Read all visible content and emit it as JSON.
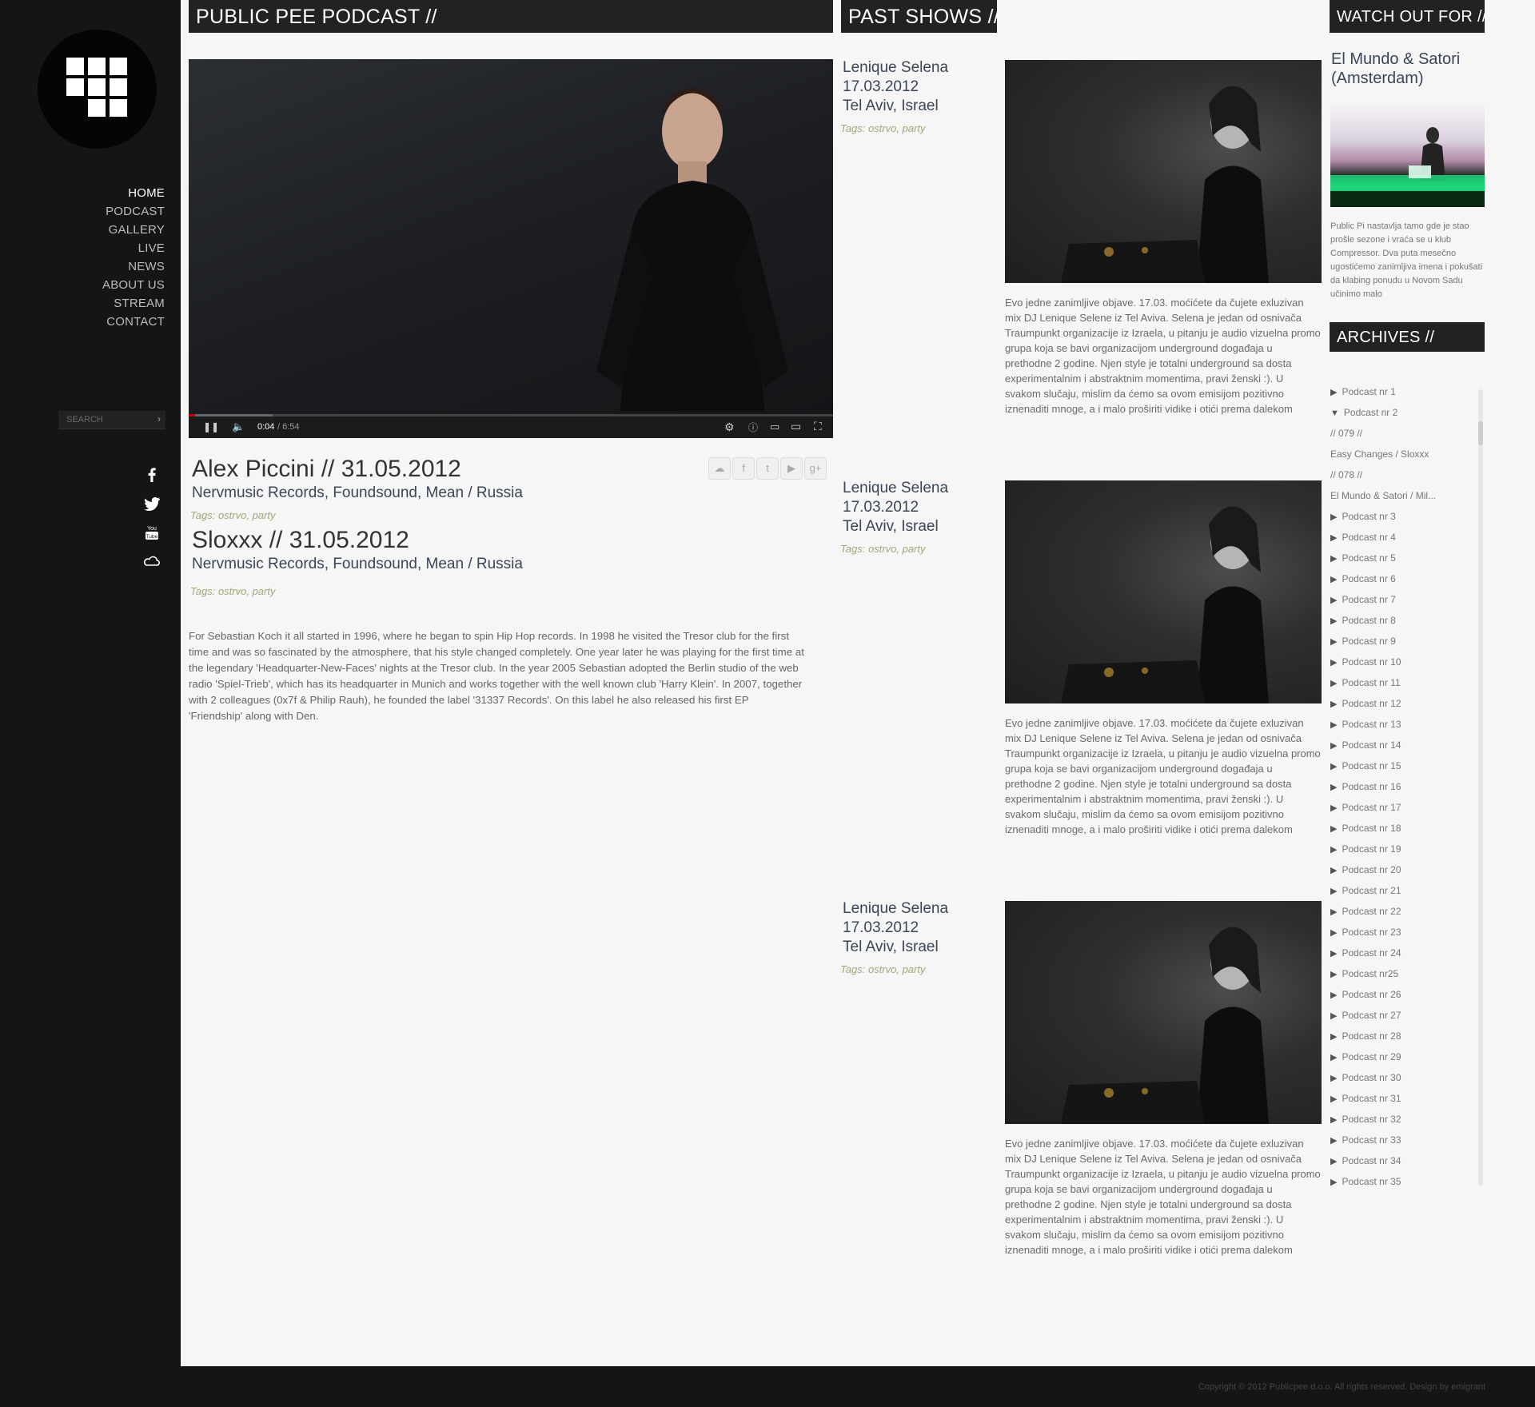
{
  "nav": {
    "items": [
      "HOME",
      "PODCAST",
      "GALLERY",
      "LIVE",
      "NEWS",
      "ABOUT US",
      "STREAM",
      "CONTACT"
    ],
    "active": "HOME"
  },
  "search": {
    "placeholder": "SEARCH",
    "go_icon": "chevron-right-icon"
  },
  "social_icons": [
    "facebook-icon",
    "twitter-icon",
    "youtube-icon",
    "soundcloud-icon"
  ],
  "main": {
    "header": "PUBLIC PEE PODCAST //",
    "video": {
      "time_current": "0:04",
      "time_total": "/ 6:54",
      "progress": 0.01
    },
    "share_icons": [
      "soundcloud-icon",
      "facebook-icon",
      "twitter-icon",
      "youtube-icon",
      "googleplus-icon"
    ],
    "shows": [
      {
        "title": "Alex Piccini // 31.05.2012",
        "subtitle": "Nervmusic Records, Foundsound, Mean / Russia",
        "tags_label": "Tags:",
        "tags": "ostrvo, party"
      },
      {
        "title": "Sloxxx // 31.05.2012",
        "subtitle": "Nervmusic Records, Foundsound, Mean / Russia",
        "tags_label": "Tags:",
        "tags": "ostrvo, party"
      }
    ],
    "bio": "For Sebastian Koch it all started in 1996, where he began to spin Hip Hop records. In 1998 he visited the Tresor club for the first time and was so fascinated by the atmosphere, that his style changed completely. One year later he was playing for the first time at the legendary 'Headquarter-New-Faces' nights at the Tresor club. In the year 2005 Sebastian adopted the Berlin studio of the web radio 'Spiel-Trieb', which has its headquarter in Munich and works together with the well known club 'Harry Klein'. In 2007, together with 2 colleagues (0x7f & Philip Rauh), he founded the label '31337 Records'. On this label he also released his first EP 'Friendship' along with Den."
  },
  "past_shows": {
    "header": "PAST SHOWS //",
    "items": [
      {
        "name": "Lenique Selena",
        "date": "17.03.2012",
        "place": "Tel Aviv, Israel",
        "tags_label": "Tags:",
        "tags": "ostrvo, party",
        "text": "Evo jedne zanimljive objave. 17.03. moćićete da čujete exluzivan mix DJ Lenique Selene iz Tel Aviva. Selena je jedan od osnivača Traumpunkt organizacije iz Izraela, u pitanju je audio vizuelna promo grupa koja se bavi organizacijom underground događaja u prethodne 2 godine. Njen style je totalni underground sa dosta experimentalnim i abstraktnim momentima, pravi ženski :). U svakom slučaju, mislim da ćemo sa ovom emisijom pozitivno iznenaditi mnoge, a i malo proširiti vidike i otići prema dalekom"
      },
      {
        "name": "Lenique Selena",
        "date": "17.03.2012",
        "place": "Tel Aviv, Israel",
        "tags_label": "Tags:",
        "tags": "ostrvo, party",
        "text": "Evo jedne zanimljive objave. 17.03. moćićete da čujete exluzivan mix DJ Lenique Selene iz Tel Aviva. Selena je jedan od osnivača Traumpunkt organizacije iz Izraela, u pitanju je audio vizuelna promo grupa koja se bavi organizacijom underground događaja u prethodne 2 godine. Njen style je totalni underground sa dosta experimentalnim i abstraktnim momentima, pravi ženski :). U svakom slučaju, mislim da ćemo sa ovom emisijom pozitivno iznenaditi mnoge, a i malo proširiti vidike i otići prema dalekom"
      },
      {
        "name": "Lenique Selena",
        "date": "17.03.2012",
        "place": "Tel Aviv, Israel",
        "tags_label": "Tags:",
        "tags": "ostrvo, party",
        "text": "Evo jedne zanimljive objave. 17.03. moćićete da čujete exluzivan mix DJ Lenique Selene iz Tel Aviva. Selena je jedan od osnivača Traumpunkt organizacije iz Izraela, u pitanju je audio vizuelna promo grupa koja se bavi organizacijom underground događaja u prethodne 2 godine. Njen style je totalni underground sa dosta experimentalnim i abstraktnim momentima, pravi ženski :). U svakom slučaju, mislim da ćemo sa ovom emisijom pozitivno iznenaditi mnoge, a i malo proširiti vidike i otići prema dalekom"
      }
    ]
  },
  "watch_out": {
    "header": "WATCH OUT FOR //",
    "title": "El Mundo & Satori (Amsterdam)",
    "text": "Public Pi nastavlja tamo gde je stao prošle sezone i vraća se u klub Compressor. Dva puta mesečno ugostićemo zanimljiva imena i pokušati da klabing ponudu u Novom Sadu učinimo malo"
  },
  "archives": {
    "header": "ARCHIVES //",
    "items": [
      {
        "label": "Podcast nr 1",
        "marker": "▶"
      },
      {
        "label": "Podcast nr 2",
        "marker": "▼"
      },
      {
        "label": " // 079 //",
        "marker": ""
      },
      {
        "label": "Easy Changes / Sloxxx",
        "marker": ""
      },
      {
        "label": " // 078 //",
        "marker": ""
      },
      {
        "label": "El Mundo & Satori / Mil...",
        "marker": ""
      },
      {
        "label": "Podcast nr 3",
        "marker": "▶"
      },
      {
        "label": "Podcast nr 4",
        "marker": "▶"
      },
      {
        "label": "Podcast nr 5",
        "marker": "▶"
      },
      {
        "label": "Podcast nr 6",
        "marker": "▶"
      },
      {
        "label": "Podcast nr 7",
        "marker": "▶"
      },
      {
        "label": "Podcast nr 8",
        "marker": "▶"
      },
      {
        "label": "Podcast nr 9",
        "marker": "▶"
      },
      {
        "label": "Podcast nr 10",
        "marker": "▶"
      },
      {
        "label": "Podcast nr 11",
        "marker": "▶"
      },
      {
        "label": "Podcast nr 12",
        "marker": "▶"
      },
      {
        "label": "Podcast nr 13",
        "marker": "▶"
      },
      {
        "label": "Podcast nr 14",
        "marker": "▶"
      },
      {
        "label": "Podcast nr 15",
        "marker": "▶"
      },
      {
        "label": "Podcast nr 16",
        "marker": "▶"
      },
      {
        "label": "Podcast nr 17",
        "marker": "▶"
      },
      {
        "label": "Podcast nr 18",
        "marker": "▶"
      },
      {
        "label": "Podcast nr 19",
        "marker": "▶"
      },
      {
        "label": "Podcast nr 20",
        "marker": "▶"
      },
      {
        "label": "Podcast nr 21",
        "marker": "▶"
      },
      {
        "label": "Podcast nr 22",
        "marker": "▶"
      },
      {
        "label": "Podcast nr 23",
        "marker": "▶"
      },
      {
        "label": "Podcast nr 24",
        "marker": "▶"
      },
      {
        "label": "Podcast nr25",
        "marker": "▶"
      },
      {
        "label": "Podcast nr 26",
        "marker": "▶"
      },
      {
        "label": "Podcast nr 27",
        "marker": "▶"
      },
      {
        "label": "Podcast nr 28",
        "marker": "▶"
      },
      {
        "label": "Podcast nr 29",
        "marker": "▶"
      },
      {
        "label": "Podcast nr 30",
        "marker": "▶"
      },
      {
        "label": "Podcast nr 31",
        "marker": "▶"
      },
      {
        "label": "Podcast nr 32",
        "marker": "▶"
      },
      {
        "label": "Podcast nr 33",
        "marker": "▶"
      },
      {
        "label": "Podcast nr 34",
        "marker": "▶"
      },
      {
        "label": "Podcast nr 35",
        "marker": "▶"
      }
    ]
  },
  "footer": {
    "copyright": "Copyright © 2012 Publicpee d.o.o. All rights reserved. Design by emigrant"
  },
  "colors": {
    "sidebar": "#151515",
    "header_bar": "#222222",
    "tags": "#a3a67a",
    "title_blue": "#3a4556",
    "page_bg": "#f6f6f6"
  }
}
